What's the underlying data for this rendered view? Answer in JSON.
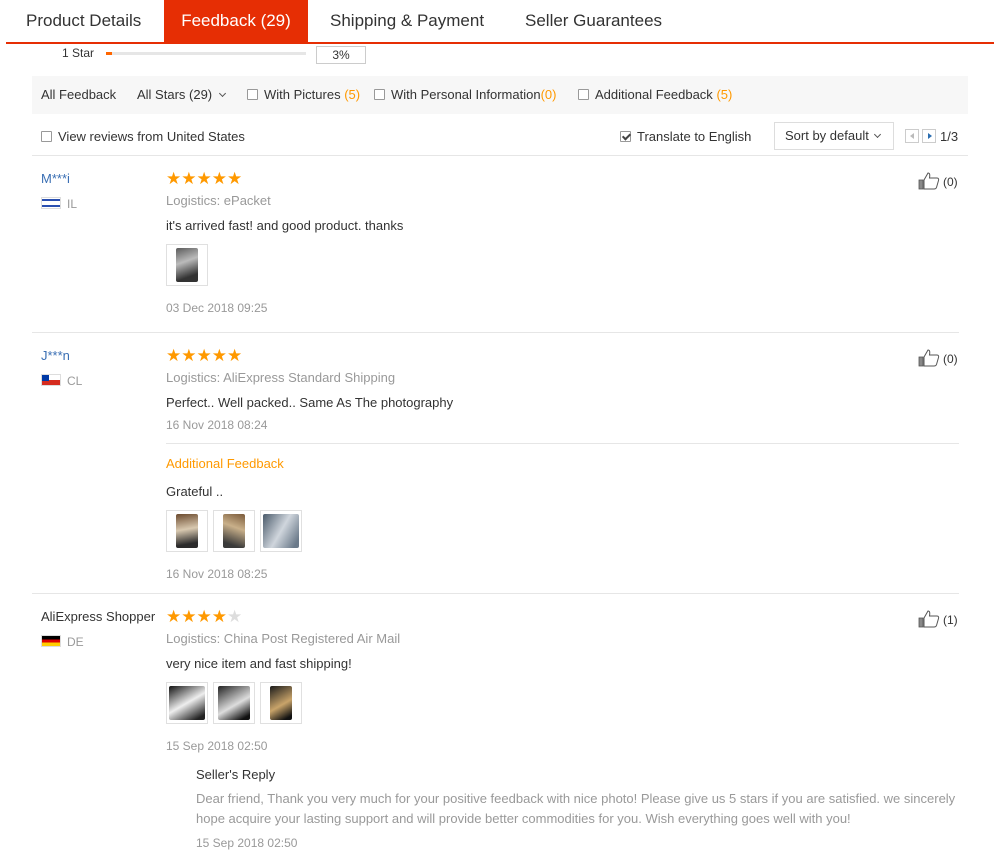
{
  "tabs": [
    {
      "label": "Product Details"
    },
    {
      "label": "Feedback (29)"
    },
    {
      "label": "Shipping & Payment"
    },
    {
      "label": "Seller Guarantees"
    }
  ],
  "rating_row": {
    "label": "1 Star",
    "percent_text": "3%",
    "fill_fraction": 0.03
  },
  "filters": {
    "all_feedback": "All Feedback",
    "all_stars": "All Stars (29)",
    "with_pictures": "With Pictures",
    "with_pictures_count": "(5)",
    "with_personal": "With Personal Information",
    "with_personal_count": "(0)",
    "additional": "Additional Feedback",
    "additional_count": "(5)"
  },
  "options": {
    "view_us": "View reviews from United States",
    "translate": "Translate to English",
    "translate_checked": true,
    "sort": "Sort by default",
    "page": "1/3"
  },
  "reviews": [
    {
      "user": "M***i",
      "country": "IL",
      "stars": 5,
      "logistics": "Logistics: ePacket",
      "text": "it's arrived fast! and good product. thanks",
      "date": "03 Dec 2018 09:25",
      "likes": "(0)"
    },
    {
      "user": "J***n",
      "country": "CL",
      "stars": 5,
      "logistics": "Logistics: AliExpress Standard Shipping",
      "text": "Perfect.. Well packed.. Same As The photography",
      "date": "16 Nov 2018 08:24",
      "additional_title": "Additional Feedback",
      "additional_text": "Grateful ..",
      "additional_date": "16 Nov 2018 08:25",
      "likes": "(0)"
    },
    {
      "user": "AliExpress Shopper",
      "country": "DE",
      "stars": 4,
      "logistics": "Logistics: China Post Registered Air Mail",
      "text": "very nice item and fast shipping!",
      "date": "15 Sep 2018 02:50",
      "likes": "(1)",
      "reply_title": "Seller's Reply",
      "reply_text": "Dear friend, Thank you very much for your positive feedback with nice photo! Please give us 5 stars if you are satisfied. we sincerely hope acquire your lasting support and will provide better commodities for you. Wish everything goes well with you!",
      "reply_date": "15 Sep 2018 02:50"
    }
  ],
  "colors": {
    "accent": "#e62e04",
    "star": "#ff9900",
    "link": "#3a6fb4",
    "muted": "#999999"
  }
}
